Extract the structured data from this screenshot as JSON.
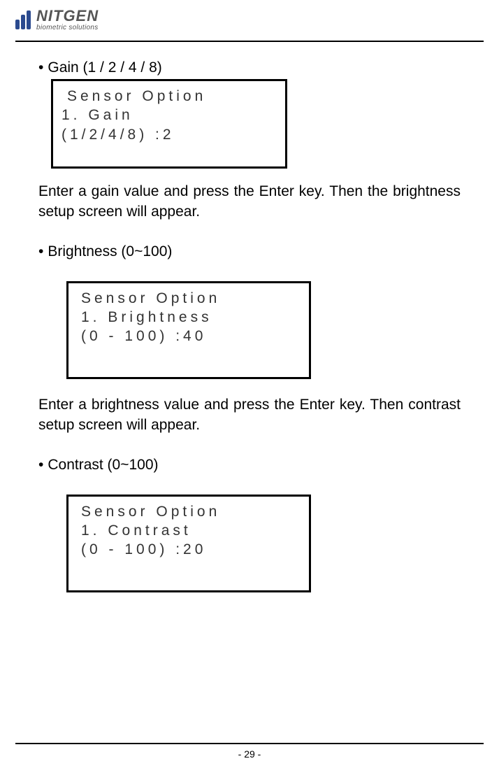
{
  "header": {
    "logo_name": "NITGEN",
    "logo_tagline": "biometric solutions"
  },
  "section1": {
    "heading": "Gain (1 / 2 / 4 / 8)",
    "display": {
      "line1": "Sensor Option",
      "line2": "1. Gain",
      "line3": "(1/2/4/8) :2"
    },
    "text": "Enter a gain value and press the Enter key. Then the brightness setup screen will appear."
  },
  "section2": {
    "heading": "Brightness (0~100)",
    "display": {
      "line1": "Sensor Option",
      "line2": "1. Brightness",
      "line3": "(0 - 100) :40"
    },
    "text": "Enter a brightness value and press the Enter key. Then contrast setup screen will appear."
  },
  "section3": {
    "heading": "Contrast (0~100)",
    "display": {
      "line1": "Sensor Option",
      "line2": "1. Contrast",
      "line3": "(0 - 100) :20"
    }
  },
  "footer": {
    "page_number": "- 29 -"
  }
}
